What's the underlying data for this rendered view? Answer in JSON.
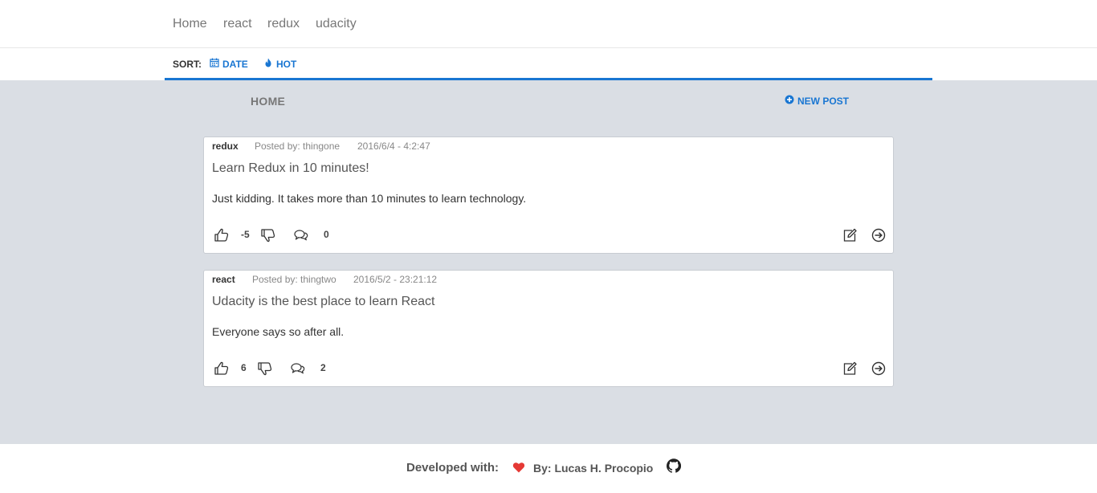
{
  "nav": {
    "links": [
      "Home",
      "react",
      "redux",
      "udacity"
    ]
  },
  "sort": {
    "label": "SORT:",
    "options": [
      {
        "label": "DATE",
        "icon": "calendar-icon"
      },
      {
        "label": "HOT",
        "icon": "fire-icon"
      }
    ]
  },
  "page": {
    "title": "HOME",
    "new_post_label": "NEW POST",
    "new_post_icon": "plus-circle-icon"
  },
  "posts": [
    {
      "category": "redux",
      "author": "Posted by: thingone",
      "date": "2016/6/4 - 4:2:47",
      "title": "Learn Redux in 10 minutes!",
      "body": "Just kidding. It takes more than 10 minutes to learn technology.",
      "score": "-5",
      "comments": "0"
    },
    {
      "category": "react",
      "author": "Posted by: thingtwo",
      "date": "2016/5/2 - 23:21:12",
      "title": "Udacity is the best place to learn React",
      "body": "Everyone says so after all.",
      "score": "6",
      "comments": "2"
    }
  ],
  "footer": {
    "developed": "Developed with:",
    "by": "By: Lucas H. Procopio"
  },
  "colors": {
    "accent": "#1976d2",
    "background": "#dadee4",
    "heart": "#e53935"
  }
}
